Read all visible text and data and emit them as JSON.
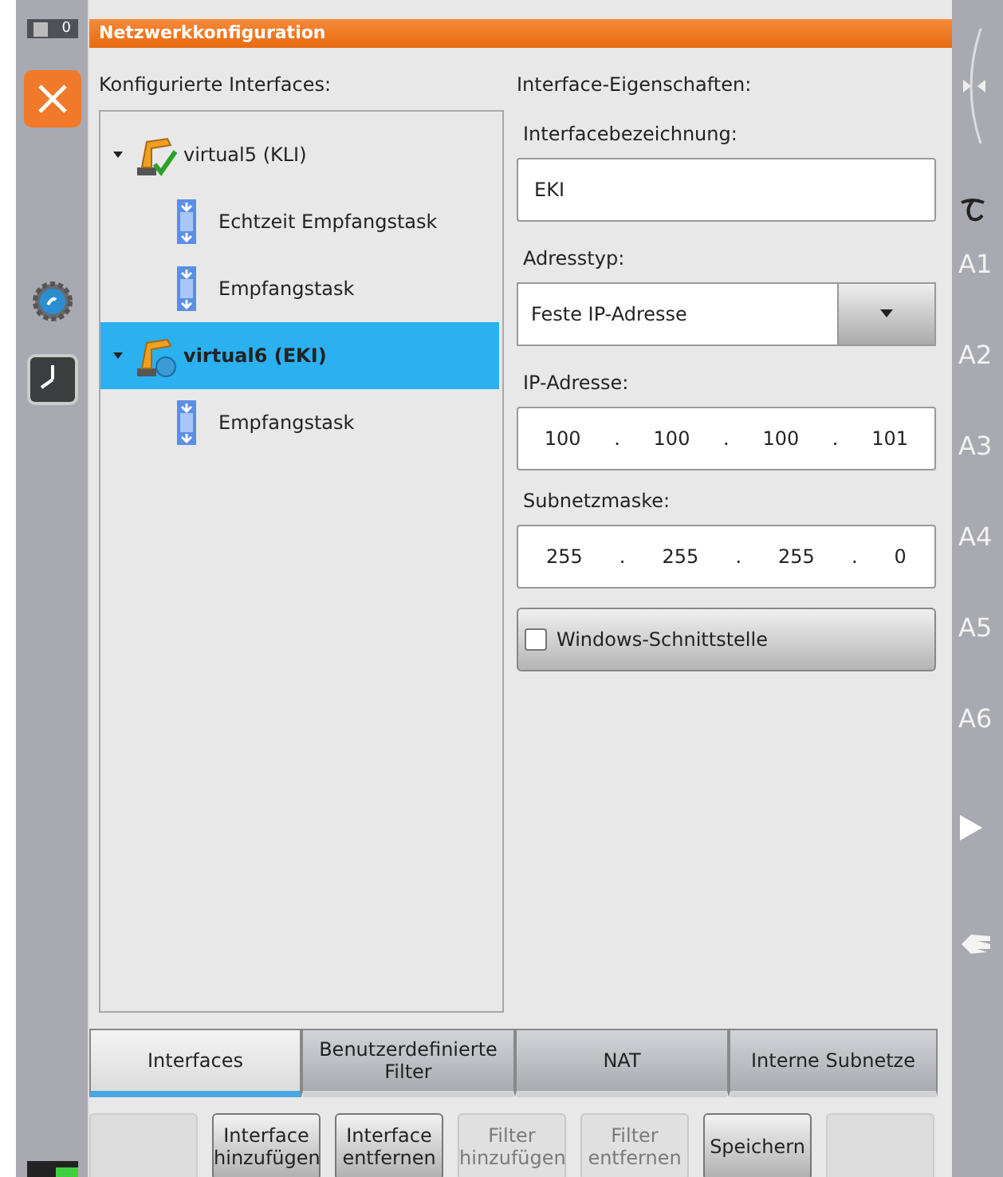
{
  "window": {
    "title": "Netzwerkkonfiguration"
  },
  "left_rail": {
    "counter": "0"
  },
  "tree": {
    "label": "Konfigurierte Interfaces:",
    "items": [
      {
        "label": "virtual5 (KLI)",
        "kind": "check",
        "selected": false,
        "expanded": true,
        "children": [
          {
            "label": "Echtzeit Empfangstask"
          },
          {
            "label": "Empfangstask"
          }
        ]
      },
      {
        "label": "virtual6 (EKI)",
        "kind": "globe",
        "selected": true,
        "expanded": true,
        "children": [
          {
            "label": "Empfangstask"
          }
        ]
      }
    ]
  },
  "properties": {
    "label": "Interface-Eigenschaften:",
    "name_field": {
      "label": "Interfacebezeichnung:",
      "value": "EKI"
    },
    "address_type": {
      "label": "Adresstyp:",
      "value": "Feste IP-Adresse"
    },
    "ip_address": {
      "label": "IP-Adresse:",
      "octets": [
        "100",
        "100",
        "100",
        "101"
      ],
      "separators": [
        ".",
        ".",
        "."
      ]
    },
    "subnet_mask": {
      "label": "Subnetzmaske:",
      "octets": [
        "255",
        "255",
        "255",
        "0"
      ],
      "separators": [
        ".",
        ".",
        "."
      ]
    },
    "windows_interface": {
      "label": "Windows-Schnittstelle",
      "checked": false
    }
  },
  "tabs": [
    {
      "label": "Interfaces",
      "selected": true
    },
    {
      "label": "Benutzerdefinierte Filter",
      "selected": false
    },
    {
      "label": "NAT",
      "selected": false
    },
    {
      "label": "Interne Subnetze",
      "selected": false
    }
  ],
  "buttons": [
    {
      "kind": "blank"
    },
    {
      "kind": "button",
      "label": "Interface hinzufügen",
      "disabled": false
    },
    {
      "kind": "button",
      "label": "Interface entfernen",
      "disabled": false
    },
    {
      "kind": "button",
      "label": "Filter hinzufügen",
      "disabled": true
    },
    {
      "kind": "button",
      "label": "Filter entfernen",
      "disabled": true
    },
    {
      "kind": "button",
      "label": "Speichern",
      "disabled": false
    },
    {
      "kind": "blank"
    }
  ],
  "right_rail": {
    "axes": [
      "A1",
      "A2",
      "A3",
      "A4",
      "A5",
      "A6"
    ]
  }
}
